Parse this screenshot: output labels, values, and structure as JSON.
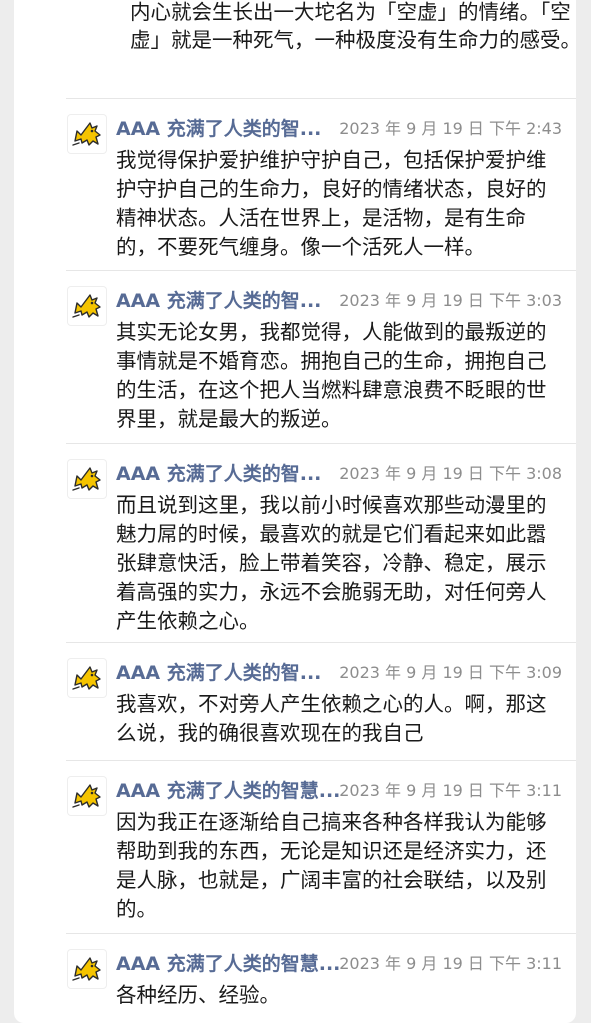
{
  "partial_text": "内心就会生长出一大坨名为「空虚」的情绪。「空虚」就是一种死气，一种极度没有生命力的感受。",
  "messages": [
    {
      "sender": "AAA 充满了人类的智...",
      "time": "2023 年 9 月 19 日  下午 2:43",
      "text": "我觉得保护爱护维护守护自己，包括保护爱护维护守护自己的生命力，良好的情绪状态，良好的精神状态。人活在世界上，是活物，是有生命的，不要死气缠身。像一个活死人一样。"
    },
    {
      "sender": "AAA 充满了人类的智...",
      "time": "2023 年 9 月 19 日  下午 3:03",
      "text": "其实无论女男，我都觉得，人能做到的最叛逆的事情就是不婚育恋。拥抱自己的生命，拥抱自己的生活，在这个把人当燃料肆意浪费不眨眼的世界里，就是最大的叛逆。"
    },
    {
      "sender": "AAA 充满了人类的智...",
      "time": "2023 年 9 月 19 日  下午 3:08",
      "text": "而且说到这里，我以前小时候喜欢那些动漫里的魅力屌的时候，最喜欢的就是它们看起来如此嚣张肆意快活，脸上带着笑容，冷静、稳定，展示着高强的实力，永远不会脆弱无助，对任何旁人产生依赖之心。"
    },
    {
      "sender": "AAA 充满了人类的智...",
      "time": "2023 年 9 月 19 日  下午 3:09",
      "text": "我喜欢，不对旁人产生依赖之心的人。啊，那这么说，我的确很喜欢现在的我自己"
    },
    {
      "sender": "AAA 充满了人类的智慧...",
      "time": "2023 年 9 月 19 日  下午 3:11",
      "text": "因为我正在逐渐给自己搞来各种各样我认为能够帮助到我的东西，无论是知识还是经济实力，还是人脉，也就是，广阔丰富的社会联结，以及别的。"
    },
    {
      "sender": "AAA 充满了人类的智慧...",
      "time": "2023 年 9 月 19 日  下午 3:11",
      "text": "各种经历、经验。"
    }
  ],
  "avatar_icon": "yellow-cat-icon",
  "colors": {
    "sender_name": "#576b95",
    "timestamp": "#8d8d8d",
    "body_text": "#1a1a1a",
    "avatar_cat": "#f5c400"
  }
}
